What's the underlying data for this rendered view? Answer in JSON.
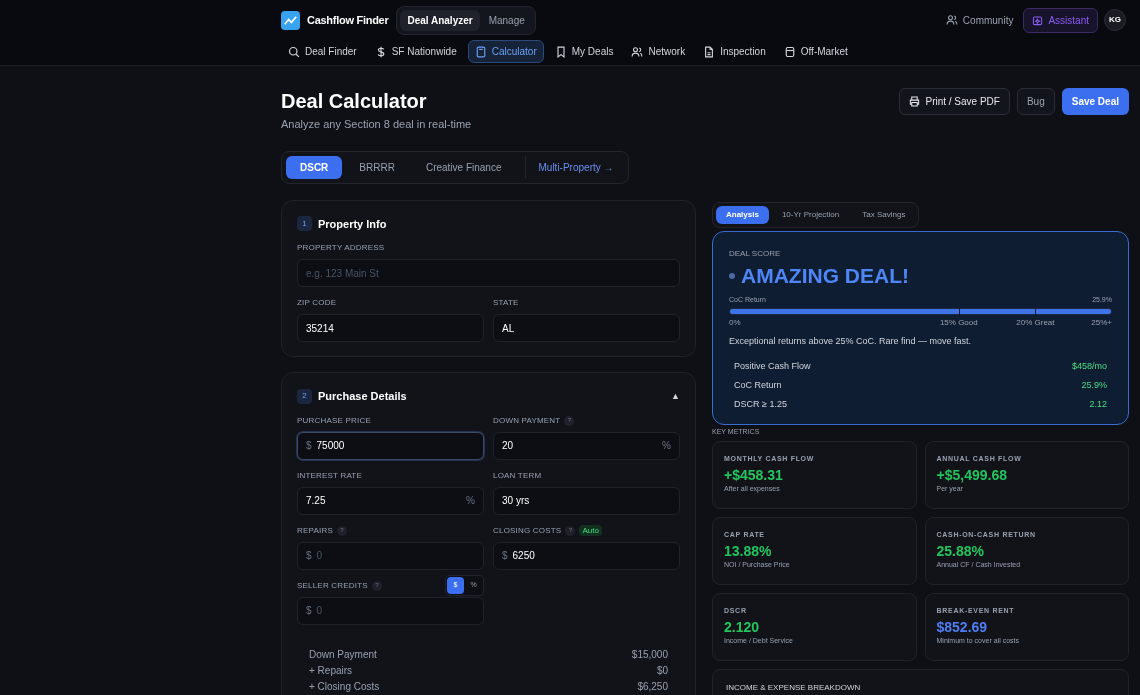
{
  "header": {
    "brand": "Cashflow Finder",
    "switch": [
      {
        "label": "Deal Analyzer",
        "selected": true
      },
      {
        "label": "Manage",
        "selected": false
      }
    ],
    "community": "Community",
    "assistant": "Assistant",
    "avatar": "KG"
  },
  "nav": [
    {
      "label": "Deal Finder",
      "selected": false
    },
    {
      "label": "SF Nationwide",
      "selected": false
    },
    {
      "label": "Calculator",
      "selected": true
    },
    {
      "label": "My Deals",
      "selected": false
    },
    {
      "label": "Network",
      "selected": false
    },
    {
      "label": "Inspection",
      "selected": false
    },
    {
      "label": "Off-Market",
      "selected": false
    }
  ],
  "page": {
    "title": "Deal Calculator",
    "subtitle": "Analyze any Section 8 deal in real-time",
    "actions": [
      {
        "label": "Print / Save PDF",
        "kind": "print"
      },
      {
        "label": "Bug",
        "kind": "plain"
      },
      {
        "label": "Save Deal",
        "kind": "primary"
      }
    ]
  },
  "modes": [
    {
      "label": "DSCR",
      "selected": true,
      "kind": "tab"
    },
    {
      "label": "BRRRR",
      "selected": false,
      "kind": "tab"
    },
    {
      "label": "Creative Finance",
      "selected": false,
      "kind": "tab"
    },
    {
      "label": "Multi-Property →",
      "selected": false,
      "kind": "link"
    }
  ],
  "sections": [
    {
      "number": "1",
      "title": "Property Info",
      "fields": [
        {
          "label": "PROPERTY ADDRESS",
          "placeholder": "e.g. 123 Main St"
        },
        {
          "label": "ZIP CODE",
          "value": "35214"
        },
        {
          "label": "STATE",
          "value": "AL"
        }
      ]
    },
    {
      "number": "2",
      "title": "Purchase Details",
      "collapse": "▲",
      "fields": [
        {
          "label": "PURCHASE PRICE",
          "prefix": "$",
          "value": "75000",
          "focused": true
        },
        {
          "label": "DOWN PAYMENT",
          "help": "?",
          "value": "20",
          "suffix": "%"
        },
        {
          "label": "INTEREST RATE",
          "value": "7.25",
          "suffix": "%"
        },
        {
          "label": "LOAN TERM",
          "value": "30 yrs"
        },
        {
          "label": "REPAIRS",
          "help": "?",
          "prefix": "$",
          "placeholder": "0"
        },
        {
          "label": "CLOSING COSTS",
          "help": "?",
          "badge": "Auto",
          "prefix": "$",
          "value": "6250"
        },
        {
          "label": "SELLER CREDITS",
          "help": "?",
          "prefix": "$",
          "placeholder": "0",
          "toggle": [
            {
              "label": "$",
              "selected": true
            },
            {
              "label": "%",
              "selected": false
            }
          ]
        }
      ],
      "summary": [
        {
          "label": "Down Payment",
          "value": "$15,000"
        },
        {
          "label": "+ Repairs",
          "value": "$0"
        },
        {
          "label": "+ Closing Costs",
          "value": "$6,250"
        }
      ]
    }
  ],
  "result_tabs": [
    {
      "label": "Analysis",
      "selected": true
    },
    {
      "label": "10-Yr Projection",
      "selected": false
    },
    {
      "label": "Tax Savings",
      "selected": false
    }
  ],
  "score": {
    "caption": "DEAL SCORE",
    "verdict": "AMAZING DEAL!",
    "meter_label": "CoC Return",
    "meter_reading": "25.9%",
    "level": 1,
    "ticks": [
      "0%",
      "15% Good",
      "20% Great",
      "25%+"
    ],
    "note": "Exceptional returns above 25% CoC. Rare find — move fast.",
    "checks": [
      {
        "label": "Positive Cash Flow",
        "value": "$458/mo"
      },
      {
        "label": "CoC Return",
        "value": "25.9%"
      },
      {
        "label": "DSCR ≥ 1.25",
        "value": "2.12"
      }
    ]
  },
  "key_metrics": {
    "title": "KEY METRICS",
    "cards": [
      {
        "label": "MONTHLY CASH FLOW",
        "value": "+$458.31",
        "note": "After all expenses",
        "color": "#22c55e"
      },
      {
        "label": "ANNUAL CASH FLOW",
        "value": "+$5,499.68",
        "note": "Per year",
        "color": "#22c55e"
      },
      {
        "label": "CAP RATE",
        "value": "13.88%",
        "note": "NOI / Purchase Price",
        "color": "#22c55e"
      },
      {
        "label": "CASH-ON-CASH RETURN",
        "value": "25.88%",
        "note": "Annual CF / Cash Invested",
        "color": "#22c55e"
      },
      {
        "label": "DSCR",
        "value": "2.120",
        "note": "Income / Debt Service",
        "color": "#22c55e"
      },
      {
        "label": "BREAK-EVEN RENT",
        "value": "$852.69",
        "note": "Minimum to cover all costs",
        "color": "#4f7df5"
      }
    ]
  },
  "breakdown": {
    "title": "INCOME & EXPENSE BREAKDOWN"
  }
}
